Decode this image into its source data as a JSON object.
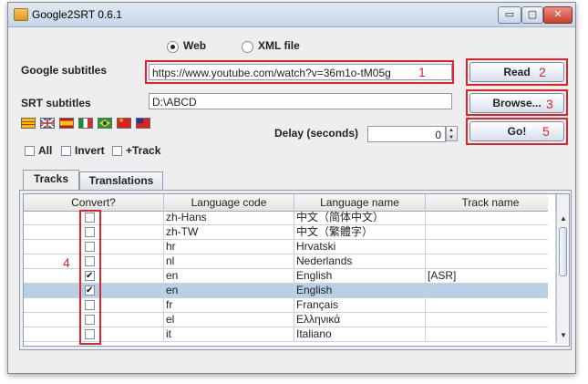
{
  "window": {
    "title": "Google2SRT 0.6.1",
    "controls": {
      "minimize": "▭",
      "maximize": "▢",
      "close": "✕"
    }
  },
  "source": {
    "options": [
      {
        "label": "Web",
        "selected": true
      },
      {
        "label": "XML file",
        "selected": false
      }
    ]
  },
  "google_subtitles": {
    "label": "Google subtitles",
    "value": "https://www.youtube.com/watch?v=36m1o-tM05g"
  },
  "srt_subtitles": {
    "label": "SRT subtitles",
    "value": "D:\\ABCD"
  },
  "buttons": {
    "read": "Read",
    "browse": "Browse...",
    "go": "Go!"
  },
  "delay": {
    "label": "Delay (seconds)",
    "value": "0"
  },
  "flags": [
    {
      "name": "flag-catalonia-icon"
    },
    {
      "name": "flag-uk-icon"
    },
    {
      "name": "flag-spain-icon"
    },
    {
      "name": "flag-italy-icon"
    },
    {
      "name": "flag-brazil-icon"
    },
    {
      "name": "flag-china-icon"
    },
    {
      "name": "flag-taiwan-icon"
    }
  ],
  "filters": [
    {
      "label": "All",
      "checked": false
    },
    {
      "label": "Invert",
      "checked": false
    },
    {
      "label": "+Track",
      "checked": false
    }
  ],
  "tabs": [
    {
      "label": "Tracks",
      "active": true
    },
    {
      "label": "Translations",
      "active": false
    }
  ],
  "table": {
    "columns": [
      "Convert?",
      "Language code",
      "Language name",
      "Track name"
    ],
    "rows": [
      {
        "convert": false,
        "code": "zh-Hans",
        "name": "中文（简体中文）",
        "track": "",
        "selected": false
      },
      {
        "convert": false,
        "code": "zh-TW",
        "name": "中文（繁體字）",
        "track": "",
        "selected": false
      },
      {
        "convert": false,
        "code": "hr",
        "name": "Hrvatski",
        "track": "",
        "selected": false
      },
      {
        "convert": false,
        "code": "nl",
        "name": "Nederlands",
        "track": "",
        "selected": false
      },
      {
        "convert": true,
        "code": "en",
        "name": "English",
        "track": "[ASR]",
        "selected": false
      },
      {
        "convert": true,
        "code": "en",
        "name": "English",
        "track": "",
        "selected": true
      },
      {
        "convert": false,
        "code": "fr",
        "name": "Français",
        "track": "",
        "selected": false
      },
      {
        "convert": false,
        "code": "el",
        "name": "Ελληνικά",
        "track": "",
        "selected": false
      },
      {
        "convert": false,
        "code": "it",
        "name": "Italiano",
        "track": "",
        "selected": false
      }
    ]
  },
  "annotations": {
    "color": "#e3232a",
    "numbers": [
      "1",
      "2",
      "3",
      "4",
      "5"
    ]
  }
}
